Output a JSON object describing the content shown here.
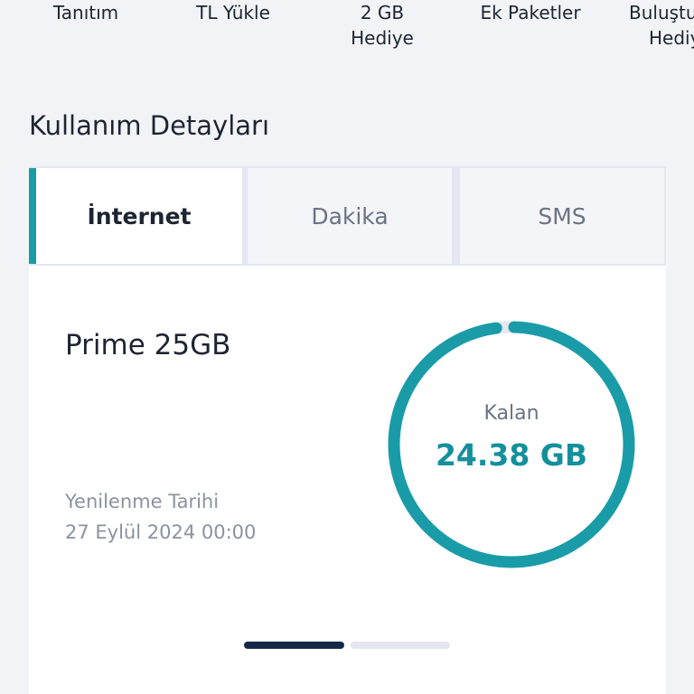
{
  "top_actions": {
    "tanitim": [
      "Tanıtım"
    ],
    "tl_yukle": [
      "TL Yükle"
    ],
    "gb_hediye": [
      "2 GB",
      "Hediye"
    ],
    "ek_paketler": [
      "Ek Paketler"
    ],
    "bulustur": [
      "Buluştu",
      "Hediy"
    ]
  },
  "usage": {
    "title": "Kullanım Detayları",
    "tabs": [
      {
        "label": "İnternet",
        "active": true
      },
      {
        "label": "Dakika",
        "active": false
      },
      {
        "label": "SMS",
        "active": false
      }
    ],
    "card": {
      "plan_name": "Prime 25GB",
      "renewal_label": "Yenilenme Tarihi",
      "renewal_date": "27 Eylül 2024 00:00",
      "remaining_label": "Kalan",
      "remaining_value": "24.38 GB",
      "remaining_gb": 24.38,
      "total_gb": 25
    },
    "pager": {
      "count": 2,
      "active_index": 0
    }
  },
  "colors": {
    "accent": "#1a9ca8",
    "gauge_track": "#e4e7ef",
    "pager_active": "#16284a",
    "pager_inactive": "#e4e7ef"
  }
}
